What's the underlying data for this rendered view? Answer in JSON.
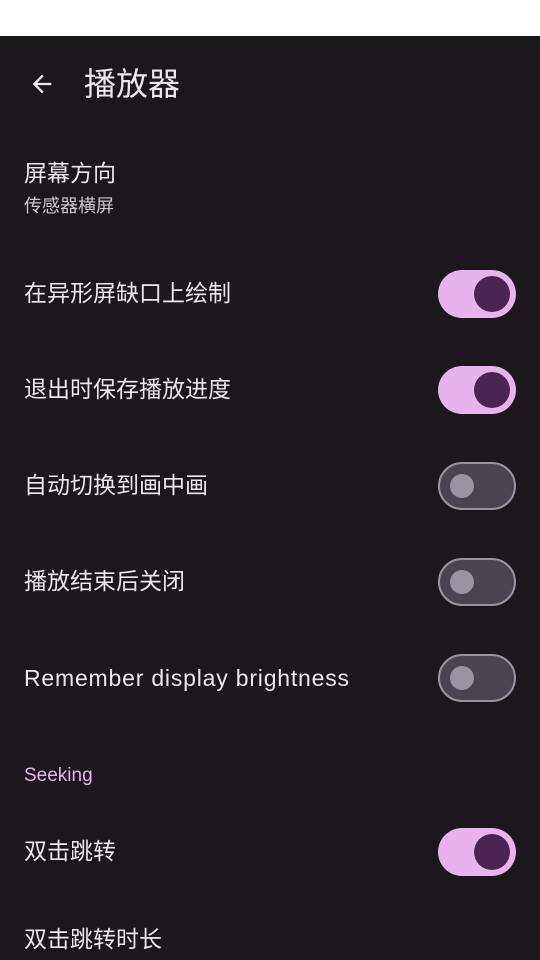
{
  "header": {
    "title": "播放器"
  },
  "settings": {
    "orientation": {
      "title": "屏幕方向",
      "value": "传感器横屏"
    },
    "cutout": {
      "title": "在异形屏缺口上绘制",
      "enabled": true
    },
    "save_progress": {
      "title": "退出时保存播放进度",
      "enabled": true
    },
    "auto_pip": {
      "title": "自动切换到画中画",
      "enabled": false
    },
    "close_on_end": {
      "title": "播放结束后关闭",
      "enabled": false
    },
    "remember_brightness": {
      "title": "Remember display brightness",
      "enabled": false
    }
  },
  "seeking": {
    "header": "Seeking",
    "double_tap_seek": {
      "title": "双击跳转",
      "enabled": true
    },
    "double_tap_duration": {
      "title": "双击跳转时长"
    }
  },
  "colors": {
    "background": "#1b171c",
    "accent": "#e8b2ef",
    "thumb_on": "#4a2352"
  }
}
